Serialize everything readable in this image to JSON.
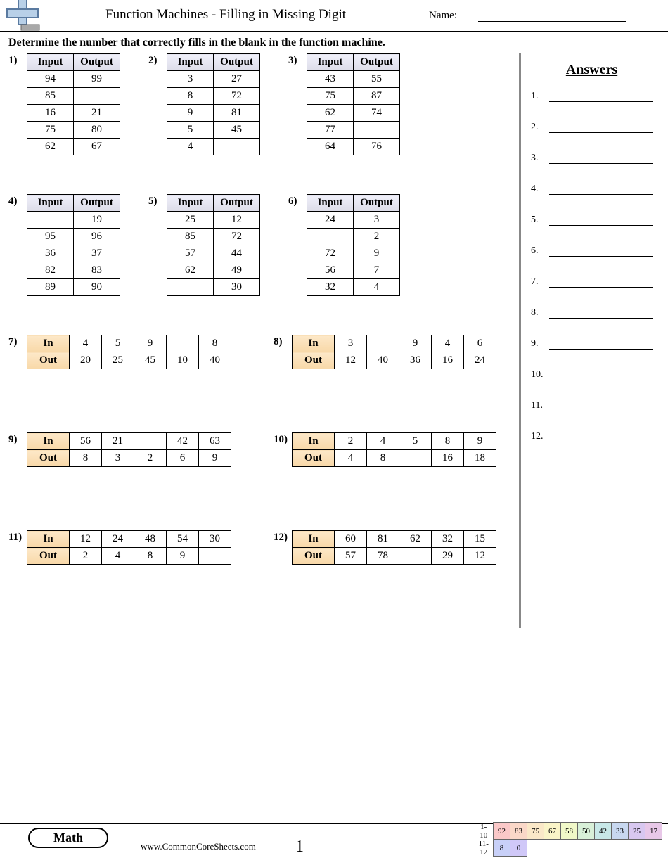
{
  "header": {
    "title": "Function Machines - Filling in Missing Digit",
    "name_label": "Name:"
  },
  "instructions": "Determine the number that correctly fills in the blank in the function machine.",
  "answers_title": "Answers",
  "answer_numbers": [
    "1.",
    "2.",
    "3.",
    "4.",
    "5.",
    "6.",
    "7.",
    "8.",
    "9.",
    "10.",
    "11.",
    "12."
  ],
  "vlabels": {
    "in": "Input",
    "out": "Output"
  },
  "hlabels": {
    "in": "In",
    "out": "Out"
  },
  "problems": {
    "p1": {
      "num": "1)",
      "rows": [
        [
          "94",
          "99"
        ],
        [
          "85",
          ""
        ],
        [
          "16",
          "21"
        ],
        [
          "75",
          "80"
        ],
        [
          "62",
          "67"
        ]
      ]
    },
    "p2": {
      "num": "2)",
      "rows": [
        [
          "3",
          "27"
        ],
        [
          "8",
          "72"
        ],
        [
          "9",
          "81"
        ],
        [
          "5",
          "45"
        ],
        [
          "4",
          ""
        ]
      ]
    },
    "p3": {
      "num": "3)",
      "rows": [
        [
          "43",
          "55"
        ],
        [
          "75",
          "87"
        ],
        [
          "62",
          "74"
        ],
        [
          "77",
          ""
        ],
        [
          "64",
          "76"
        ]
      ]
    },
    "p4": {
      "num": "4)",
      "rows": [
        [
          "",
          "19"
        ],
        [
          "95",
          "96"
        ],
        [
          "36",
          "37"
        ],
        [
          "82",
          "83"
        ],
        [
          "89",
          "90"
        ]
      ]
    },
    "p5": {
      "num": "5)",
      "rows": [
        [
          "25",
          "12"
        ],
        [
          "85",
          "72"
        ],
        [
          "57",
          "44"
        ],
        [
          "62",
          "49"
        ],
        [
          "",
          "30"
        ]
      ]
    },
    "p6": {
      "num": "6)",
      "rows": [
        [
          "24",
          "3"
        ],
        [
          "",
          "2"
        ],
        [
          "72",
          "9"
        ],
        [
          "56",
          "7"
        ],
        [
          "32",
          "4"
        ]
      ]
    },
    "p7": {
      "num": "7)",
      "in": [
        "4",
        "5",
        "9",
        "",
        "8"
      ],
      "out": [
        "20",
        "25",
        "45",
        "10",
        "40"
      ]
    },
    "p8": {
      "num": "8)",
      "in": [
        "3",
        "",
        "9",
        "4",
        "6"
      ],
      "out": [
        "12",
        "40",
        "36",
        "16",
        "24"
      ]
    },
    "p9": {
      "num": "9)",
      "in": [
        "56",
        "21",
        "",
        "42",
        "63"
      ],
      "out": [
        "8",
        "3",
        "2",
        "6",
        "9"
      ]
    },
    "p10": {
      "num": "10)",
      "in": [
        "2",
        "4",
        "5",
        "8",
        "9"
      ],
      "out": [
        "4",
        "8",
        "",
        "16",
        "18"
      ]
    },
    "p11": {
      "num": "11)",
      "in": [
        "12",
        "24",
        "48",
        "54",
        "30"
      ],
      "out": [
        "2",
        "4",
        "8",
        "9",
        ""
      ]
    },
    "p12": {
      "num": "12)",
      "in": [
        "60",
        "81",
        "62",
        "32",
        "15"
      ],
      "out": [
        "57",
        "78",
        "",
        "29",
        "12"
      ]
    }
  },
  "footer": {
    "math": "Math",
    "url": "www.CommonCoreSheets.com",
    "page": "1",
    "score": {
      "r1label": "1-10",
      "r1": [
        "92",
        "83",
        "75",
        "67",
        "58",
        "50",
        "42",
        "33",
        "25",
        "17"
      ],
      "r2label": "11-12",
      "r2": [
        "8",
        "0"
      ]
    }
  }
}
